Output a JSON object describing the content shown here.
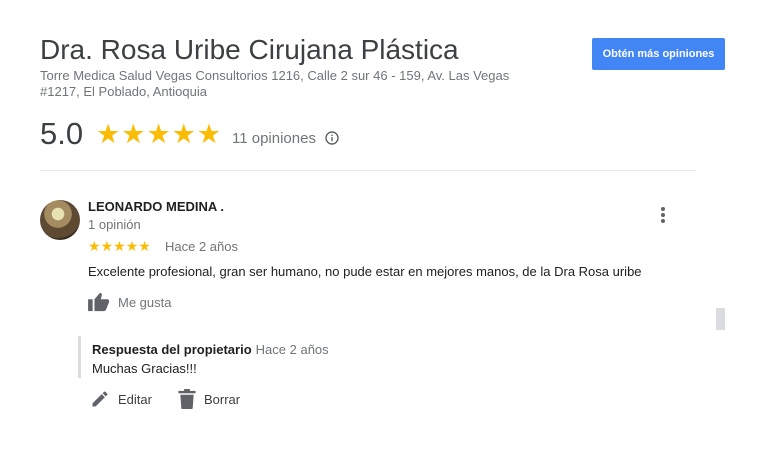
{
  "business": {
    "name": "Dra. Rosa Uribe Cirujana Plástica",
    "address": "Torre Medica Salud Vegas Consultorios 1216, Calle 2 sur 46 - 159, Av. Las Vegas #1217, El Poblado, Antioquia",
    "cta_label": "Obtén más opiniones",
    "rating": "5.0",
    "stars": 5,
    "review_count_label": "11 opiniones"
  },
  "review": {
    "author": "LEONARDO MEDINA .",
    "author_reviews": "1 opinión",
    "stars": 5,
    "time": "Hace 2 años",
    "text": "Excelente profesional, gran ser humano, no pude estar en mejores manos, de la Dra Rosa uribe",
    "like_label": "Me gusta"
  },
  "reply": {
    "title": "Respuesta del propietario",
    "time": "Hace 2 años",
    "text": "Muchas Gracias!!!",
    "edit_label": "Editar",
    "delete_label": "Borrar"
  },
  "colors": {
    "accent": "#4285f4",
    "star": "#fbbc04",
    "secondary_text": "#70757a"
  },
  "icons": [
    "info-icon",
    "star-icon",
    "more-vert-icon",
    "thumb-up-icon",
    "edit-icon",
    "delete-icon"
  ]
}
